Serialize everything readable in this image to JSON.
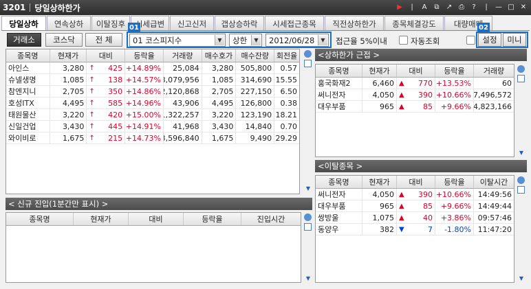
{
  "window": {
    "code": "3201",
    "title": "당일상하한가"
  },
  "tabs": [
    "당일상하",
    "연속상하",
    "이탈징후",
    "시세급변",
    "신고신저",
    "갭상승하락",
    "시세접근종목",
    "직전상하한가",
    "종목체결강도",
    "대량매매"
  ],
  "markets": [
    "거래소",
    "코스닥",
    "전 체"
  ],
  "badges": {
    "b1": "01",
    "b2": "02"
  },
  "index_select": "01  코스피지수",
  "limit_select": "상한",
  "date_value": "2012/06/28",
  "approach_label": "접근율 5%이내",
  "auto_label": "자동조회",
  "settings_label": "설정",
  "mini_label": "미니",
  "main_table": {
    "headers": [
      "종목명",
      "현재가",
      "대비",
      "등락율",
      "거래량",
      "매수호가",
      "매수잔량",
      "회전율"
    ],
    "rows": [
      {
        "name": "아인스",
        "price": "3,280",
        "diff": "425",
        "rate": "+14.89%",
        "vol": "25,084",
        "bid": "3,280",
        "bidqty": "505,800",
        "turn": "0.57"
      },
      {
        "name": "슈넬생명",
        "price": "1,085",
        "diff": "138",
        "rate": "+14.57%",
        "vol": "8,079,956",
        "bid": "1,085",
        "bidqty": "314,690",
        "turn": "15.55"
      },
      {
        "name": "참엔지니",
        "price": "2,705",
        "diff": "350",
        "rate": "+14.86%",
        "vol": "2,120,868",
        "bid": "2,705",
        "bidqty": "227,150",
        "turn": "6.50"
      },
      {
        "name": "호성ITX",
        "price": "4,495",
        "diff": "585",
        "rate": "+14.96%",
        "vol": "43,906",
        "bid": "4,495",
        "bidqty": "126,800",
        "turn": "0.38"
      },
      {
        "name": "태원물산",
        "price": "3,220",
        "diff": "420",
        "rate": "+15.00%",
        "vol": "1,322,257",
        "bid": "3,220",
        "bidqty": "123,190",
        "turn": "18.21"
      },
      {
        "name": "신일건업",
        "price": "3,430",
        "diff": "445",
        "rate": "+14.91%",
        "vol": "41,968",
        "bid": "3,430",
        "bidqty": "14,840",
        "turn": "0.70"
      },
      {
        "name": "와이비로",
        "price": "1,675",
        "diff": "215",
        "rate": "+14.73%",
        "vol": "3,596,840",
        "bid": "1,675",
        "bidqty": "9,490",
        "turn": "29.29"
      }
    ]
  },
  "new_entry": {
    "title": "< 신규 진입(1분간만 표시) >",
    "headers": [
      "종목명",
      "현재가",
      "대비",
      "등락율",
      "진입시간"
    ]
  },
  "near_limit": {
    "title": "<상하한가 근접 >",
    "headers": [
      "종목명",
      "현재가",
      "대비",
      "등락율",
      "거래량"
    ],
    "rows": [
      {
        "name": "홍국화재2",
        "price": "6,460",
        "diff": "770",
        "rate": "+13.53%",
        "vol": "60"
      },
      {
        "name": "써니전자",
        "price": "4,050",
        "diff": "390",
        "rate": "+10.66%",
        "vol": "7,496,572"
      },
      {
        "name": "대우부품",
        "price": "965",
        "diff": "85",
        "rate": "+9.66%",
        "vol": "4,823,166"
      }
    ]
  },
  "breakout": {
    "title": "<이탈종목 >",
    "headers": [
      "종목명",
      "현재가",
      "대비",
      "등락율",
      "이탈시간"
    ],
    "rows": [
      {
        "name": "써니전자",
        "price": "4,050",
        "diff": "390",
        "rate": "+10.66%",
        "time": "14:49:56",
        "dir": "up"
      },
      {
        "name": "대우부품",
        "price": "965",
        "diff": "85",
        "rate": "+9.66%",
        "time": "14:49:44",
        "dir": "up"
      },
      {
        "name": "쌍방울",
        "price": "1,075",
        "diff": "40",
        "rate": "+3.86%",
        "time": "09:57:46",
        "dir": "up"
      },
      {
        "name": "동양우",
        "price": "382",
        "diff": "7",
        "rate": "-1.80%",
        "time": "11:47:20",
        "dir": "down"
      }
    ]
  },
  "colors": {
    "accent": "#1b6fc2",
    "up": "#e0002a",
    "down": "#0044cc"
  }
}
